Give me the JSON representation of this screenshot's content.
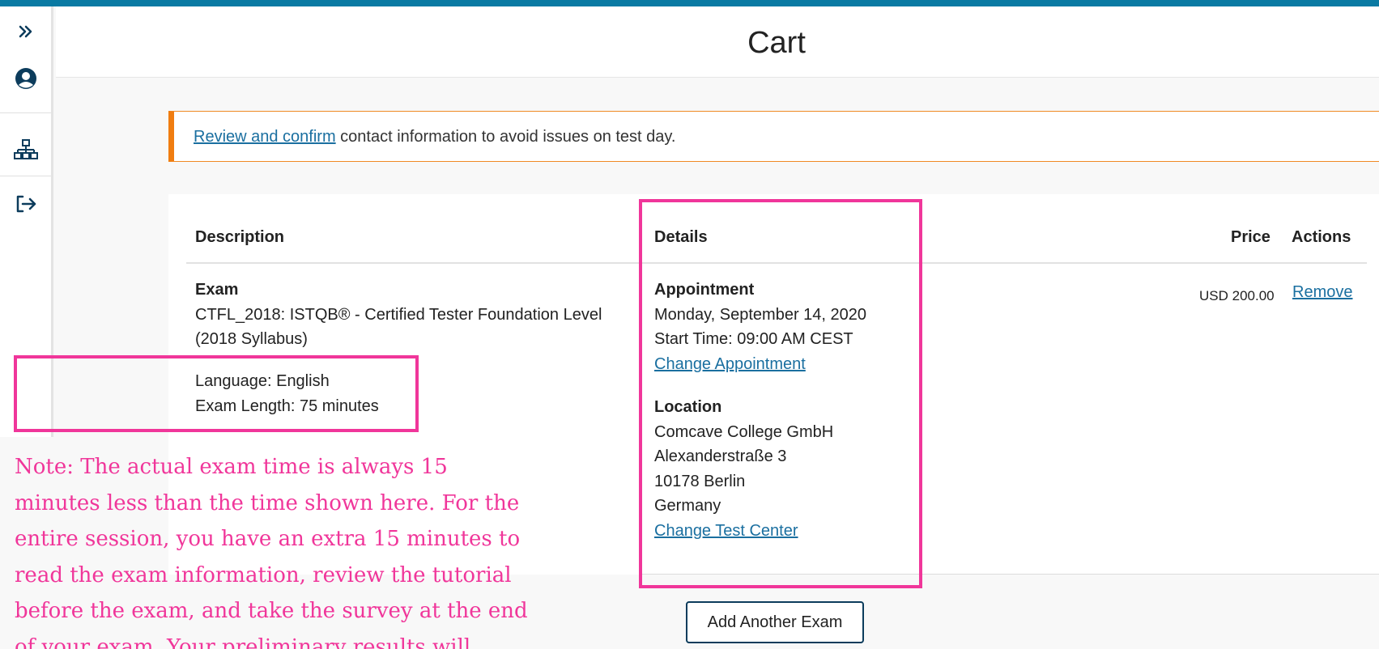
{
  "header": {
    "title": "Cart"
  },
  "sidebar": {
    "items": [
      {
        "name": "expand",
        "icon": "double-chevron-right-icon"
      },
      {
        "name": "profile",
        "icon": "user-circle-icon"
      },
      {
        "name": "sitemap",
        "icon": "sitemap-icon"
      },
      {
        "name": "sign-out",
        "icon": "sign-out-icon"
      }
    ]
  },
  "alert": {
    "link": "Review and confirm",
    "text": " contact information to avoid issues on test day."
  },
  "table": {
    "headers": {
      "description": "Description",
      "details": "Details",
      "price": "Price",
      "actions": "Actions"
    },
    "row": {
      "type": "Exam",
      "name_line1": "CTFL_2018: ISTQB® - Certified Tester Foundation Level",
      "name_line2": "(2018 Syllabus)",
      "language": "Language: English",
      "length": "Exam Length: 75 minutes",
      "appointment_title": "Appointment",
      "date": "Monday, September 14, 2020",
      "start_time": "Start Time: 09:00 AM CEST",
      "change_appointment": "Change Appointment",
      "location_title": "Location",
      "loc_line1": "Comcave College GmbH",
      "loc_line2": "Alexanderstraße 3",
      "loc_line3": "10178 Berlin",
      "loc_line4": "Germany",
      "change_test_center": "Change Test Center",
      "price": "USD 200.00",
      "remove": "Remove"
    }
  },
  "add_button": "Add Another Exam",
  "note": {
    "lines": [
      "Note:  The actual exam time is always 15",
      "minutes less than the time shown here. For the",
      "entire session, you have an extra 15 minutes to",
      "read the exam information, review the tutorial",
      "before the exam, and take the survey at the end",
      "of your exam. Your preliminary results will"
    ]
  },
  "colors": {
    "accent": "#0a7aa3",
    "alert_border": "#f07d10",
    "highlight": "#f0369a",
    "link": "#1a6fa0",
    "nav_icon": "#0c3c5c"
  }
}
